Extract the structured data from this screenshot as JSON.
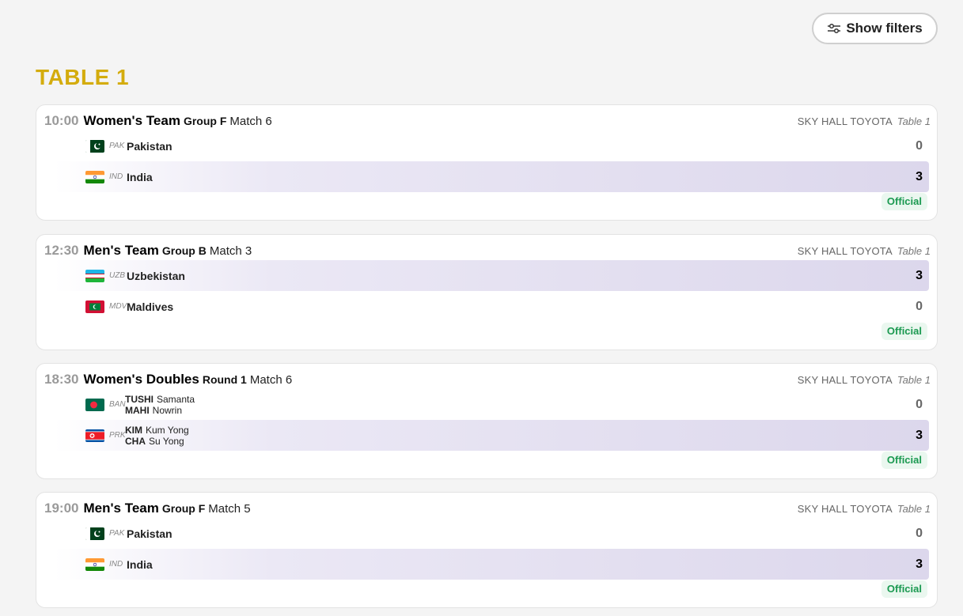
{
  "toolbar": {
    "show_filters_label": "Show filters",
    "icon": "sliders-icon"
  },
  "section": {
    "title": "TABLE 1"
  },
  "matches": [
    {
      "time": "10:00",
      "event": "Women's Team",
      "round": "Group F",
      "match": "Match 6",
      "venue": "SKY HALL TOYOTA",
      "table": "Table 1",
      "status": "Official",
      "sides": [
        {
          "code": "PAK",
          "name": "Pakistan",
          "score": "0",
          "flag": "pakistan-flag-icon"
        },
        {
          "code": "IND",
          "name": "India",
          "score": "3",
          "flag": "india-flag-icon"
        }
      ]
    },
    {
      "time": "12:30",
      "event": "Men's Team",
      "round": "Group B",
      "match": "Match 3",
      "venue": "SKY HALL TOYOTA",
      "table": "Table 1",
      "status": "Official",
      "sides": [
        {
          "code": "UZB",
          "name": "Uzbekistan",
          "score": "3",
          "flag": "uzbekistan-flag-icon"
        },
        {
          "code": "MDV",
          "name": "Maldives",
          "score": "0",
          "flag": "maldives-flag-icon"
        }
      ]
    },
    {
      "time": "18:30",
      "event": "Women's Doubles",
      "round": "Round 1",
      "match": "Match 6",
      "venue": "SKY HALL TOYOTA",
      "table": "Table 1",
      "status": "Official",
      "sides": [
        {
          "code": "BAN",
          "score": "0",
          "flag": "bangladesh-flag-icon",
          "players": [
            {
              "last": "TUSHI",
              "first": "Samanta"
            },
            {
              "last": "MAHI",
              "first": "Nowrin"
            }
          ]
        },
        {
          "code": "PRK",
          "score": "3",
          "flag": "north-korea-flag-icon",
          "players": [
            {
              "last": "KIM",
              "first": "Kum Yong"
            },
            {
              "last": "CHA",
              "first": "Su Yong"
            }
          ]
        }
      ]
    },
    {
      "time": "19:00",
      "event": "Men's Team",
      "round": "Group F",
      "match": "Match 5",
      "venue": "SKY HALL TOYOTA",
      "table": "Table 1",
      "status": "Official",
      "sides": [
        {
          "code": "PAK",
          "name": "Pakistan",
          "score": "0",
          "flag": "pakistan-flag-icon"
        },
        {
          "code": "IND",
          "name": "India",
          "score": "3",
          "flag": "india-flag-icon"
        }
      ]
    }
  ],
  "colors": {
    "accent": "#d4ac0d",
    "winner_bg": "#dcd7ec",
    "official_text": "#1a9950",
    "official_bg": "#eaf7ef"
  }
}
